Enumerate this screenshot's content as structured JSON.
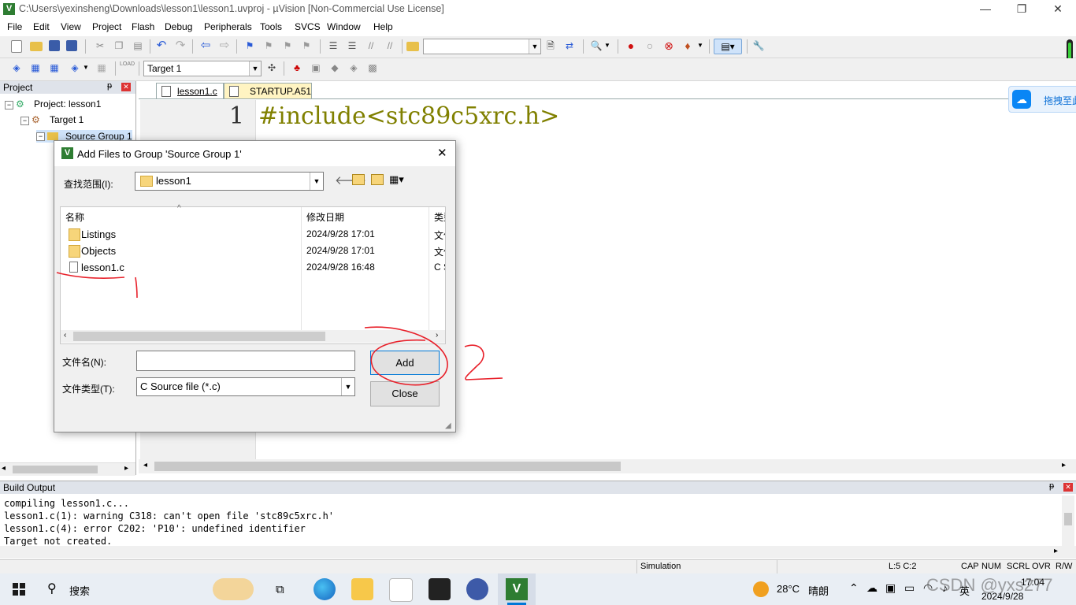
{
  "window": {
    "title": "C:\\Users\\yexinsheng\\Downloads\\lesson1\\lesson1.uvproj - µVision  [Non-Commercial Use License]",
    "minimize": "—",
    "restore": "❐",
    "close": "✕"
  },
  "menu": [
    "File",
    "Edit",
    "View",
    "Project",
    "Flash",
    "Debug",
    "Peripherals",
    "Tools",
    "SVCS",
    "Window",
    "Help"
  ],
  "toolbar2": {
    "target_label": "Target 1",
    "load_label": "LOAD"
  },
  "project_pane": {
    "title": "Project",
    "root": "Project: lesson1",
    "target": "Target 1",
    "group": "Source Group 1"
  },
  "editor": {
    "tabs": [
      {
        "label": "lesson1.c",
        "active": true
      },
      {
        "label": "STARTUP.A51",
        "active": false
      }
    ],
    "line_number": "1",
    "code_line": "#include<stc89c5xrc.h>"
  },
  "cloud_badge": "拖拽至此",
  "dialog": {
    "title": "Add Files to Group 'Source Group 1'",
    "look_in_label": "查找范围(I):",
    "look_in_value": "lesson1",
    "columns": {
      "name": "名称",
      "date": "修改日期",
      "type": "类型"
    },
    "files": [
      {
        "name": "Listings",
        "date": "2024/9/28 17:01",
        "type": "文件夹",
        "icon": "folder-icon"
      },
      {
        "name": "Objects",
        "date": "2024/9/28 17:01",
        "type": "文件夹",
        "icon": "folder-icon"
      },
      {
        "name": "lesson1.c",
        "date": "2024/9/28 16:48",
        "type": "C Source",
        "icon": "c-file-icon"
      }
    ],
    "filename_label": "文件名(N):",
    "filename_value": "",
    "filetype_label": "文件类型(T):",
    "filetype_value": "C Source file (*.c)",
    "add_label": "Add",
    "close_label": "Close"
  },
  "build_output": {
    "title": "Build Output",
    "lines": [
      "compiling lesson1.c...",
      "lesson1.c(1): warning C318: can't open file 'stc89c5xrc.h'",
      "lesson1.c(4): error C202: 'P10': undefined identifier",
      "Target not created."
    ]
  },
  "status_bar": {
    "mode": "Simulation",
    "position": "L:5 C:2",
    "indicators": [
      "CAP",
      "NUM",
      "SCRL",
      "OVR",
      "R/W"
    ]
  },
  "taskbar": {
    "search_label": "搜索",
    "weather_temp": "28°C",
    "weather_text": "晴朗",
    "time": "17:04",
    "date": "2024/9/28",
    "ime": "英",
    "watermark": "CSDN @yxs277"
  },
  "colors": {
    "annotation_red": "#e8202a",
    "accent_blue": "#0078d7",
    "code_olive": "#808000"
  }
}
